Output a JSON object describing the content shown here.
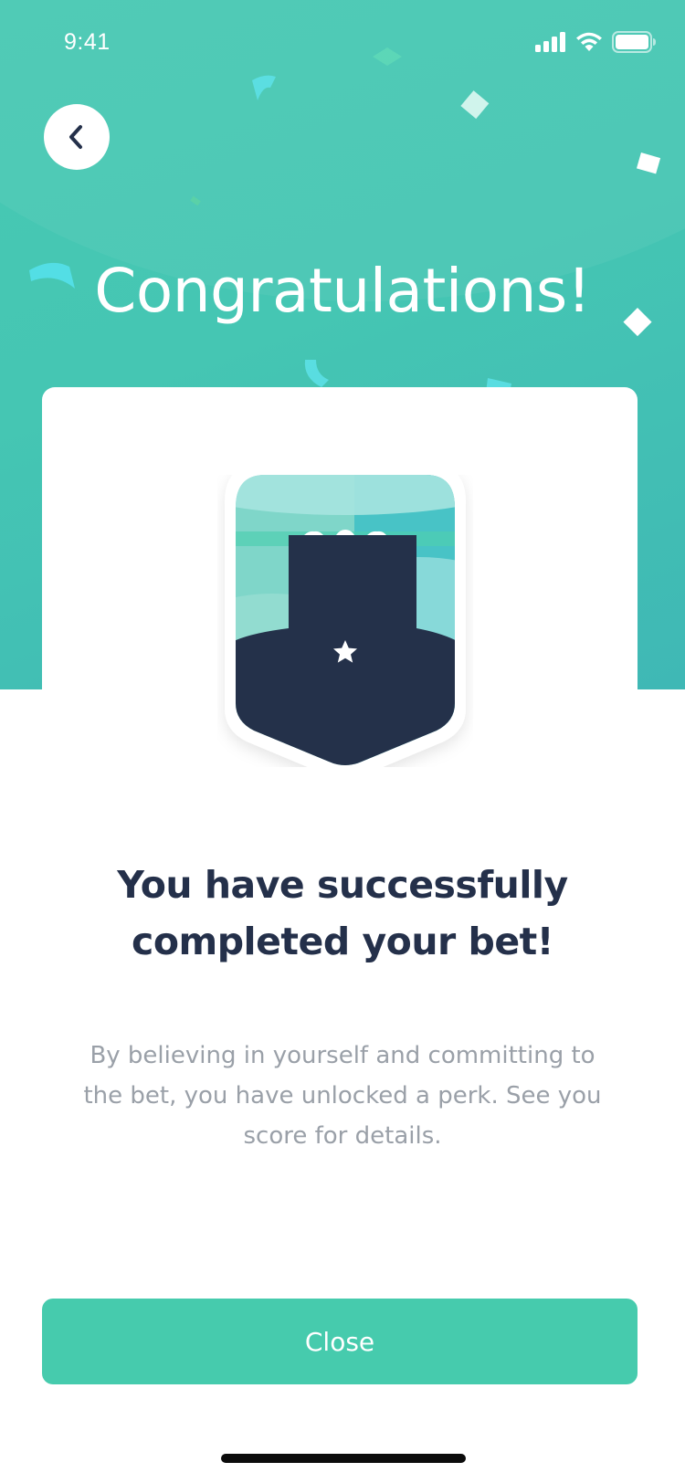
{
  "status_bar": {
    "time": "9:41",
    "icons": [
      "cellular-signal-icon",
      "wifi-icon",
      "battery-icon"
    ]
  },
  "header": {
    "back_icon": "chevron-left-icon",
    "title": "Congratulations!"
  },
  "badge": {
    "icon": "star-icon"
  },
  "main": {
    "headline": "You have successfully completed your bet!",
    "description": "By believing in yourself and committing to the bet, you have unlocked a perk. See you score for details."
  },
  "actions": {
    "close_label": "Close"
  },
  "colors": {
    "hero_bg": "#45c6b3",
    "accent": "#46cbad",
    "navy": "#24304a",
    "muted_text": "#9aa0a8"
  }
}
